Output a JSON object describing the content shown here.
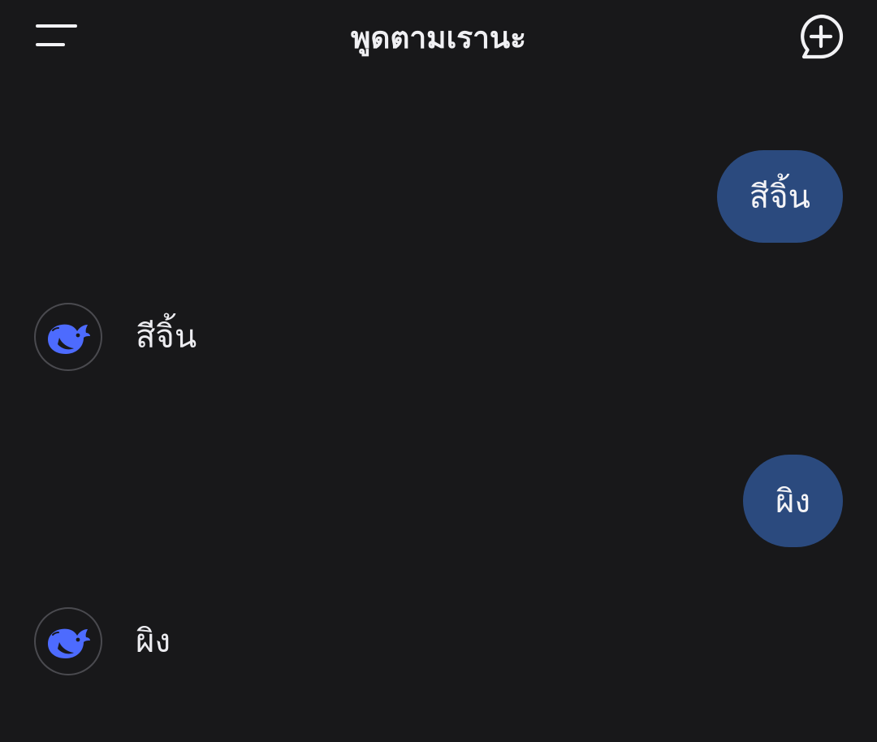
{
  "header": {
    "title": "พูดตามเรานะ",
    "menu_icon": "hamburger-menu-icon",
    "new_chat_icon": "new-chat-plus-bubble-icon"
  },
  "conversation": [
    {
      "role": "user",
      "text": "สีจิ้น"
    },
    {
      "role": "assistant",
      "avatar_icon": "whale-logo-icon",
      "text": "สีจิ้น"
    },
    {
      "role": "user",
      "text": "ผิง"
    },
    {
      "role": "assistant",
      "avatar_icon": "whale-logo-icon",
      "text": "ผิง"
    }
  ],
  "colors": {
    "background": "#18181a",
    "user_bubble": "#2b4a7e",
    "logo_blue": "#4d6bfe",
    "text": "#ececf0"
  }
}
